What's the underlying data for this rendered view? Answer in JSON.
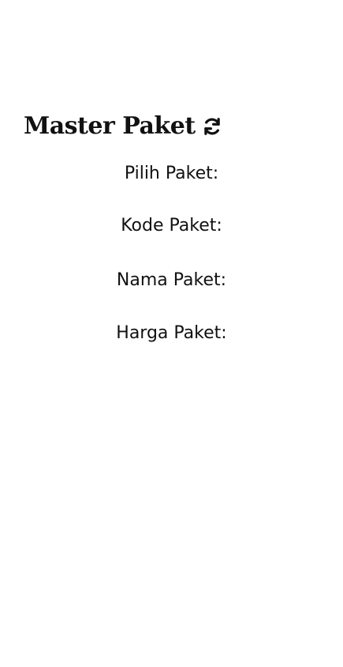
{
  "header": {
    "title": "Master Paket",
    "refresh_icon": "refresh-icon"
  },
  "form": {
    "pilih_paket_label": "Pilih Paket:",
    "kode_paket_label": "Kode Paket:",
    "nama_paket_label": "Nama Paket:",
    "harga_paket_label": "Harga Paket:"
  }
}
